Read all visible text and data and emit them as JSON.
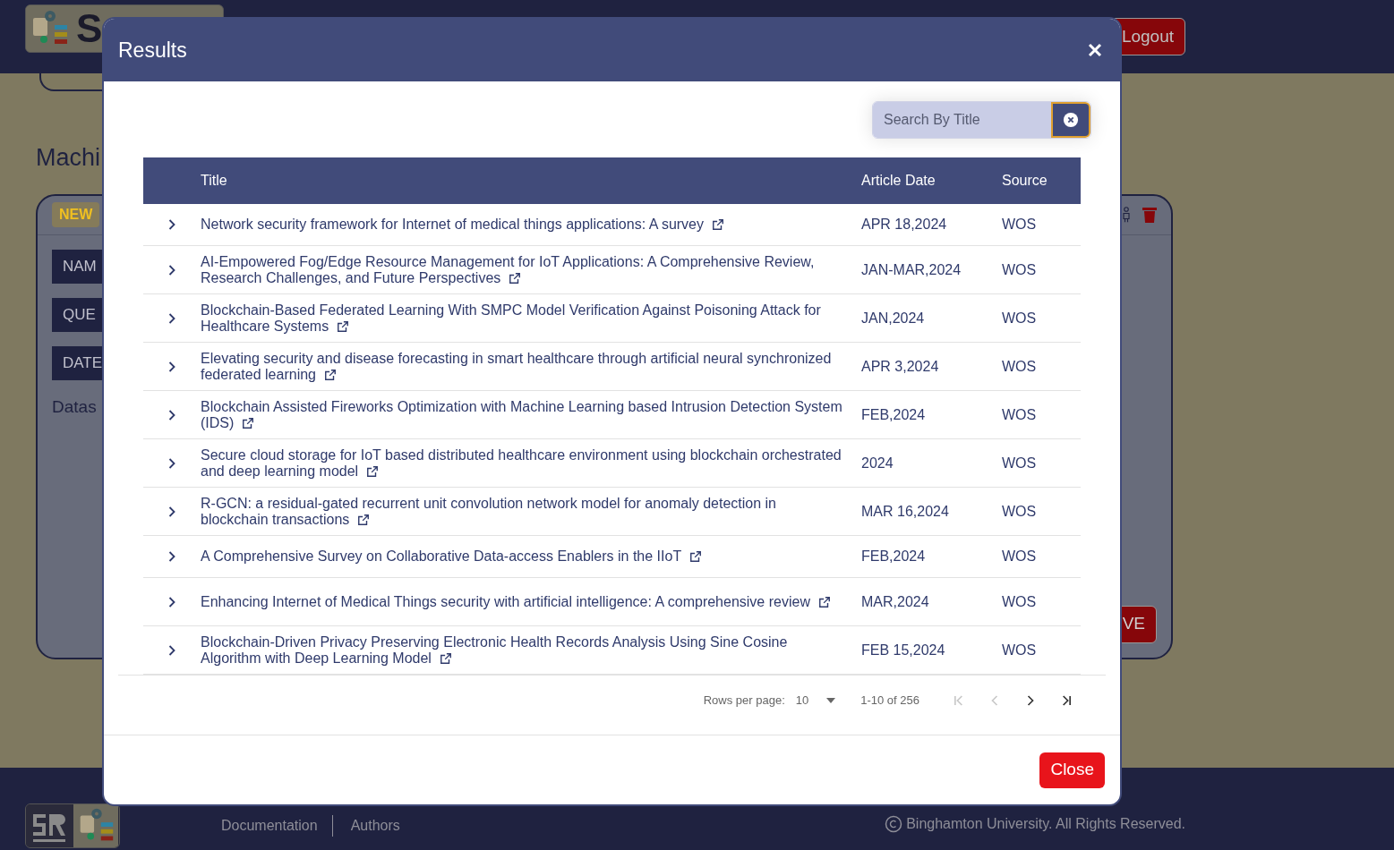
{
  "header": {
    "logo_text": "S",
    "logout": "Logout"
  },
  "page": {
    "heading": "Machi",
    "card": {
      "badge": "NEW",
      "fields": [
        "NAM",
        "QUE",
        "DATE"
      ],
      "dataset_label": "Datas",
      "save": "VE"
    }
  },
  "modal": {
    "title": "Results",
    "search": {
      "placeholder": "Search By Title"
    },
    "table": {
      "columns": [
        "Title",
        "Article Date",
        "Source"
      ],
      "rows": [
        {
          "title": "Network security framework for Internet of medical things applications: A survey",
          "date": "APR 18,2024",
          "source": "WOS",
          "expanded": false
        },
        {
          "title": "AI-Empowered Fog/Edge Resource Management for IoT Applications: A Comprehensive Review, Research Challenges, and Future Perspectives",
          "date": "JAN-MAR,2024",
          "source": "WOS",
          "expanded": false
        },
        {
          "title": "Blockchain-Based Federated Learning With SMPC Model Verification Against Poisoning Attack for Healthcare Systems",
          "date": "JAN,2024",
          "source": "WOS",
          "expanded": false
        },
        {
          "title": "Elevating security and disease forecasting in smart healthcare through artificial neural synchronized federated learning",
          "date": "APR 3,2024",
          "source": "WOS",
          "expanded": false
        },
        {
          "title": "Blockchain Assisted Fireworks Optimization with Machine Learning based Intrusion Detection System (IDS)",
          "date": "FEB,2024",
          "source": "WOS",
          "expanded": false
        },
        {
          "title": "Secure cloud storage for IoT based distributed healthcare environment using blockchain orchestrated and deep learning model",
          "date": "2024",
          "source": "WOS",
          "expanded": false
        },
        {
          "title": "R-GCN: a residual-gated recurrent unit convolution network model for anomaly detection in blockchain transactions",
          "date": "MAR 16,2024",
          "source": "WOS",
          "expanded": false
        },
        {
          "title": "A Comprehensive Survey on Collaborative Data-access Enablers in the IIoT",
          "date": "FEB,2024",
          "source": "WOS",
          "expanded": false
        },
        {
          "title": "Enhancing Internet of Medical Things security with artificial intelligence: A comprehensive review",
          "date": "MAR,2024",
          "source": "WOS",
          "expanded": false
        },
        {
          "title": "Blockchain-Driven Privacy Preserving Electronic Health Records Analysis Using Sine Cosine Algorithm with Deep Learning Model",
          "date": "FEB 15,2024",
          "source": "WOS",
          "expanded": false
        }
      ]
    },
    "pagination": {
      "rows_label": "Rows per page:",
      "rows_value": "10",
      "range": "1-10 of 256",
      "first_disabled": true,
      "prev_disabled": true,
      "next_disabled": false,
      "last_disabled": false
    },
    "close": "Close"
  },
  "footer": {
    "links": [
      "Documentation",
      "Authors"
    ],
    "copyright": "Binghamton University. All Rights Reserved."
  }
}
